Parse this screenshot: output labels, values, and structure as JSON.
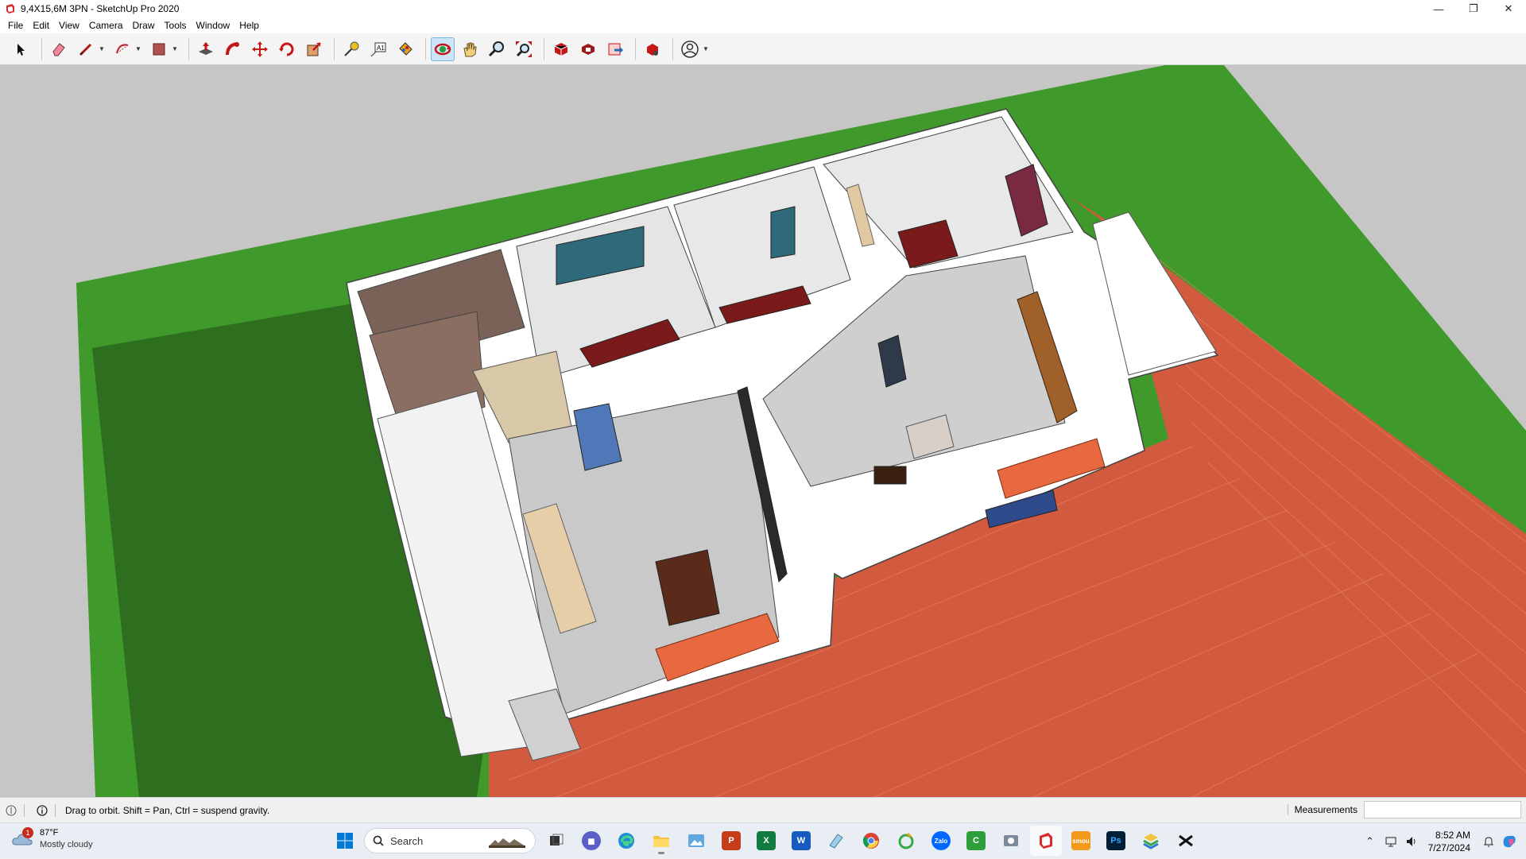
{
  "window": {
    "title": "9,4X15,6M 3PN - SketchUp Pro 2020",
    "minimize": "—",
    "maximize": "❐",
    "close": "✕"
  },
  "menu": {
    "items": [
      "File",
      "Edit",
      "View",
      "Camera",
      "Draw",
      "Tools",
      "Window",
      "Help"
    ]
  },
  "toolbar": {
    "tools": [
      "select",
      "eraser",
      "line",
      "arc",
      "rectangle",
      "push-pull",
      "follow-me",
      "move",
      "rotate",
      "scale",
      "tape-measure",
      "text",
      "paint-bucket",
      "orbit",
      "pan",
      "zoom",
      "zoom-extents",
      "3d-warehouse",
      "extension-warehouse",
      "send-to-layout",
      "extension-manager",
      "account"
    ],
    "active_tool": "orbit"
  },
  "status": {
    "hint": "Drag to orbit. Shift = Pan, Ctrl = suspend gravity.",
    "measurements_label": "Measurements",
    "measurements_value": ""
  },
  "taskbar": {
    "weather_temp": "87°F",
    "weather_desc": "Mostly cloudy",
    "weather_badge": "1",
    "search_placeholder": "Search",
    "time": "8:52 AM",
    "date": "7/27/2024",
    "apps": [
      "start",
      "search",
      "task-view",
      "meet",
      "edge",
      "file-explorer",
      "photos",
      "powerpoint",
      "excel",
      "word",
      "sticky",
      "chrome",
      "winrar",
      "zalo",
      "camtasia",
      "snipping",
      "sketchup",
      "smoothscan",
      "photoshop",
      "bluestacks",
      "capcut"
    ]
  },
  "colors": {
    "grass": "#3f9a2b",
    "grass_shadow": "#2d6e1f",
    "tile": "#d25a3e",
    "wall": "#ffffff",
    "floor": "#c4c4c4",
    "roof_tile": "#e8693f",
    "accent": "#0067c0"
  }
}
